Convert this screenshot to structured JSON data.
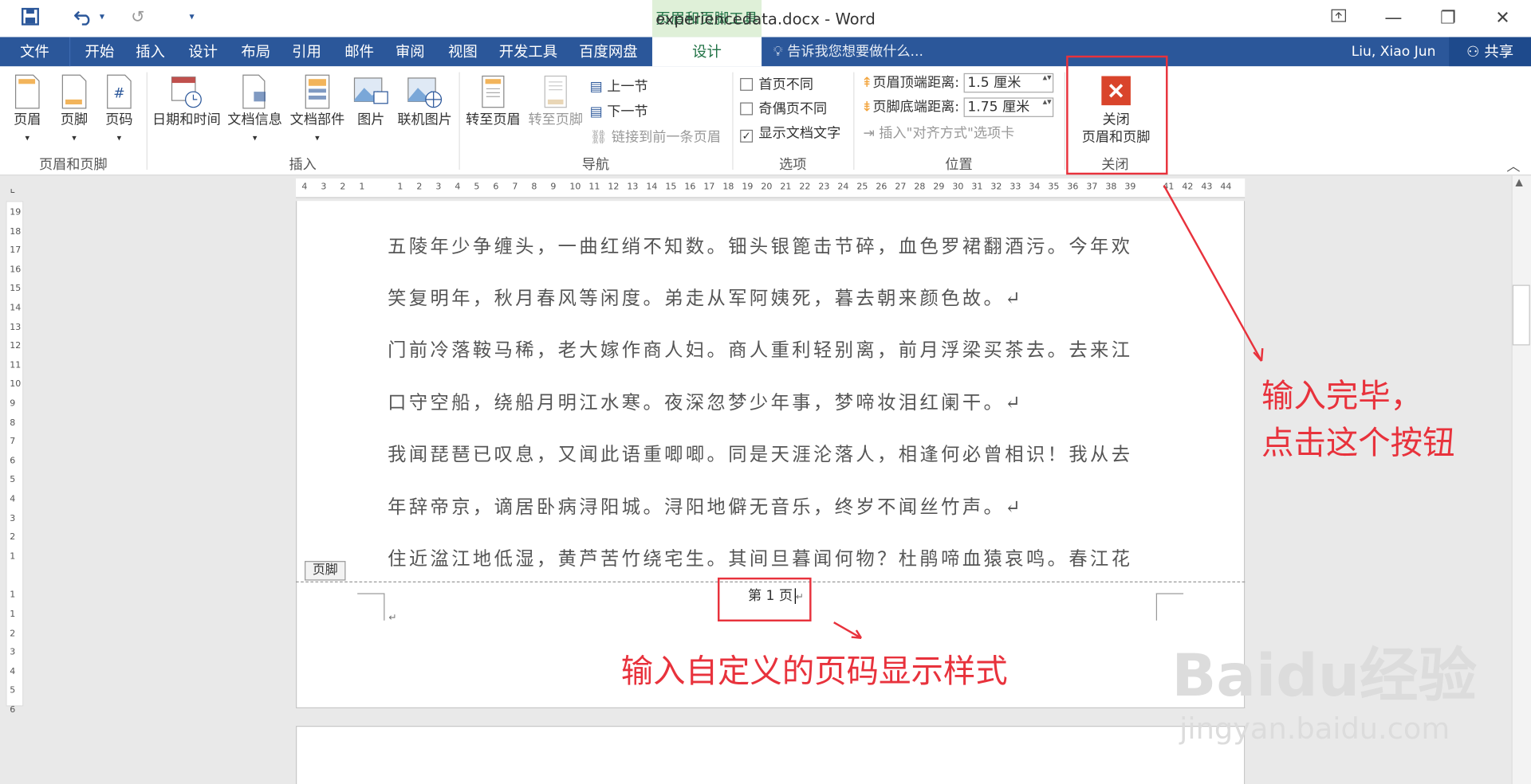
{
  "window": {
    "title": "experiencedata.docx - Word",
    "context_tab_group": "页眉和页脚工具"
  },
  "tabs": [
    "文件",
    "开始",
    "插入",
    "设计",
    "布局",
    "引用",
    "邮件",
    "审阅",
    "视图",
    "开发工具",
    "百度网盘",
    "设计"
  ],
  "tell_me": "告诉我您想要做什么...",
  "user_name": "Liu, Xiao Jun",
  "share_label": "共享",
  "ribbon": {
    "group_hf": {
      "label": "页眉和页脚",
      "buttons": [
        "页眉",
        "页脚",
        "页码"
      ]
    },
    "group_insert": {
      "label": "插入",
      "buttons": [
        "日期和时间",
        "文档信息",
        "文档部件",
        "图片",
        "联机图片"
      ]
    },
    "group_nav": {
      "label": "导航",
      "buttons": [
        "转至页眉",
        "转至页脚"
      ],
      "prev": "上一节",
      "next": "下一节",
      "link": "链接到前一条页眉"
    },
    "group_options": {
      "label": "选项",
      "first_diff": "首页不同",
      "odd_even": "奇偶页不同",
      "show_text": "显示文档文字",
      "show_text_checked": true
    },
    "group_position": {
      "label": "位置",
      "header_label": "页眉顶端距离:",
      "header_value": "1.5 厘米",
      "footer_label": "页脚底端距离:",
      "footer_value": "1.75 厘米",
      "align_tab": "插入\"对齐方式\"选项卡"
    },
    "group_close": {
      "label": "关闭",
      "button_line1": "关闭",
      "button_line2": "页眉和页脚"
    }
  },
  "ruler": {
    "h_ticks": [
      "4",
      "3",
      "2",
      "1",
      "",
      "1",
      "2",
      "3",
      "4",
      "5",
      "6",
      "7",
      "8",
      "9",
      "10",
      "11",
      "12",
      "13",
      "14",
      "15",
      "16",
      "17",
      "18",
      "19",
      "20",
      "21",
      "22",
      "23",
      "24",
      "25",
      "26",
      "27",
      "28",
      "29",
      "30",
      "31",
      "32",
      "33",
      "34",
      "35",
      "36",
      "37",
      "38",
      "39",
      "",
      "41",
      "42",
      "43",
      "44"
    ],
    "v_ticks_top": [
      "19",
      "18",
      "17",
      "16",
      "15",
      "14",
      "13",
      "12",
      "11",
      "10",
      "9",
      "8",
      "7",
      "6",
      "5",
      "4",
      "3",
      "2",
      "1"
    ],
    "v_ticks_bottom": [
      "1",
      "1",
      "2",
      "3",
      "4",
      "5",
      "6"
    ]
  },
  "document": {
    "lines": [
      "五陵年少争缠头，一曲红绡不知数。钿头银篦击节碎，血色罗裙翻酒污。今年欢",
      "笑复明年，秋月春风等闲度。弟走从军阿姨死，暮去朝来颜色故。↵",
      "门前冷落鞍马稀，老大嫁作商人妇。商人重利轻别离，前月浮梁买茶去。去来江",
      "口守空船，绕船月明江水寒。夜深忽梦少年事，梦啼妆泪红阑干。↵",
      "我闻琵琶已叹息，又闻此语重唧唧。同是天涯沦落人，相逢何必曾相识！我从去",
      "年辞帝京，谪居卧病浔阳城。浔阳地僻无音乐，终岁不闻丝竹声。↵",
      "住近湓江地低湿，黄芦苦竹绕宅生。其间旦暮闻何物？杜鹃啼血猿哀鸣。春江花"
    ],
    "footer_tag": "页脚",
    "footer_text": "第 1 页",
    "footer_mark": "↵"
  },
  "annotations": {
    "close_hint_1": "输入完毕，",
    "close_hint_2": "点击这个按钮",
    "footer_hint": "输入自定义的页码显示样式"
  },
  "watermark": {
    "brand": "Baidu经验",
    "url": "jingyan.baidu.com"
  },
  "colors": {
    "word_blue": "#2b579a",
    "context_green": "#217346",
    "annotation_red": "#e8323c",
    "close_icon_red": "#d9442b"
  }
}
